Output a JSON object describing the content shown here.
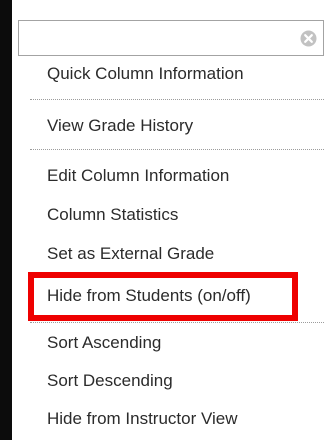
{
  "menu": {
    "close_icon": "close-circle-icon",
    "groups": [
      {
        "items": [
          "Quick Column Information"
        ]
      },
      {
        "items": [
          "View Grade History"
        ]
      },
      {
        "items": [
          "Edit Column Information",
          "Column Statistics",
          "Set as External Grade",
          "Hide from Students (on/off)"
        ]
      },
      {
        "items": [
          "Sort Ascending",
          "Sort Descending",
          "Hide from Instructor View"
        ]
      }
    ]
  },
  "colors": {
    "highlight": "#ee0000",
    "sidebar": "#0c0c0c",
    "text": "#2b2b2b"
  }
}
